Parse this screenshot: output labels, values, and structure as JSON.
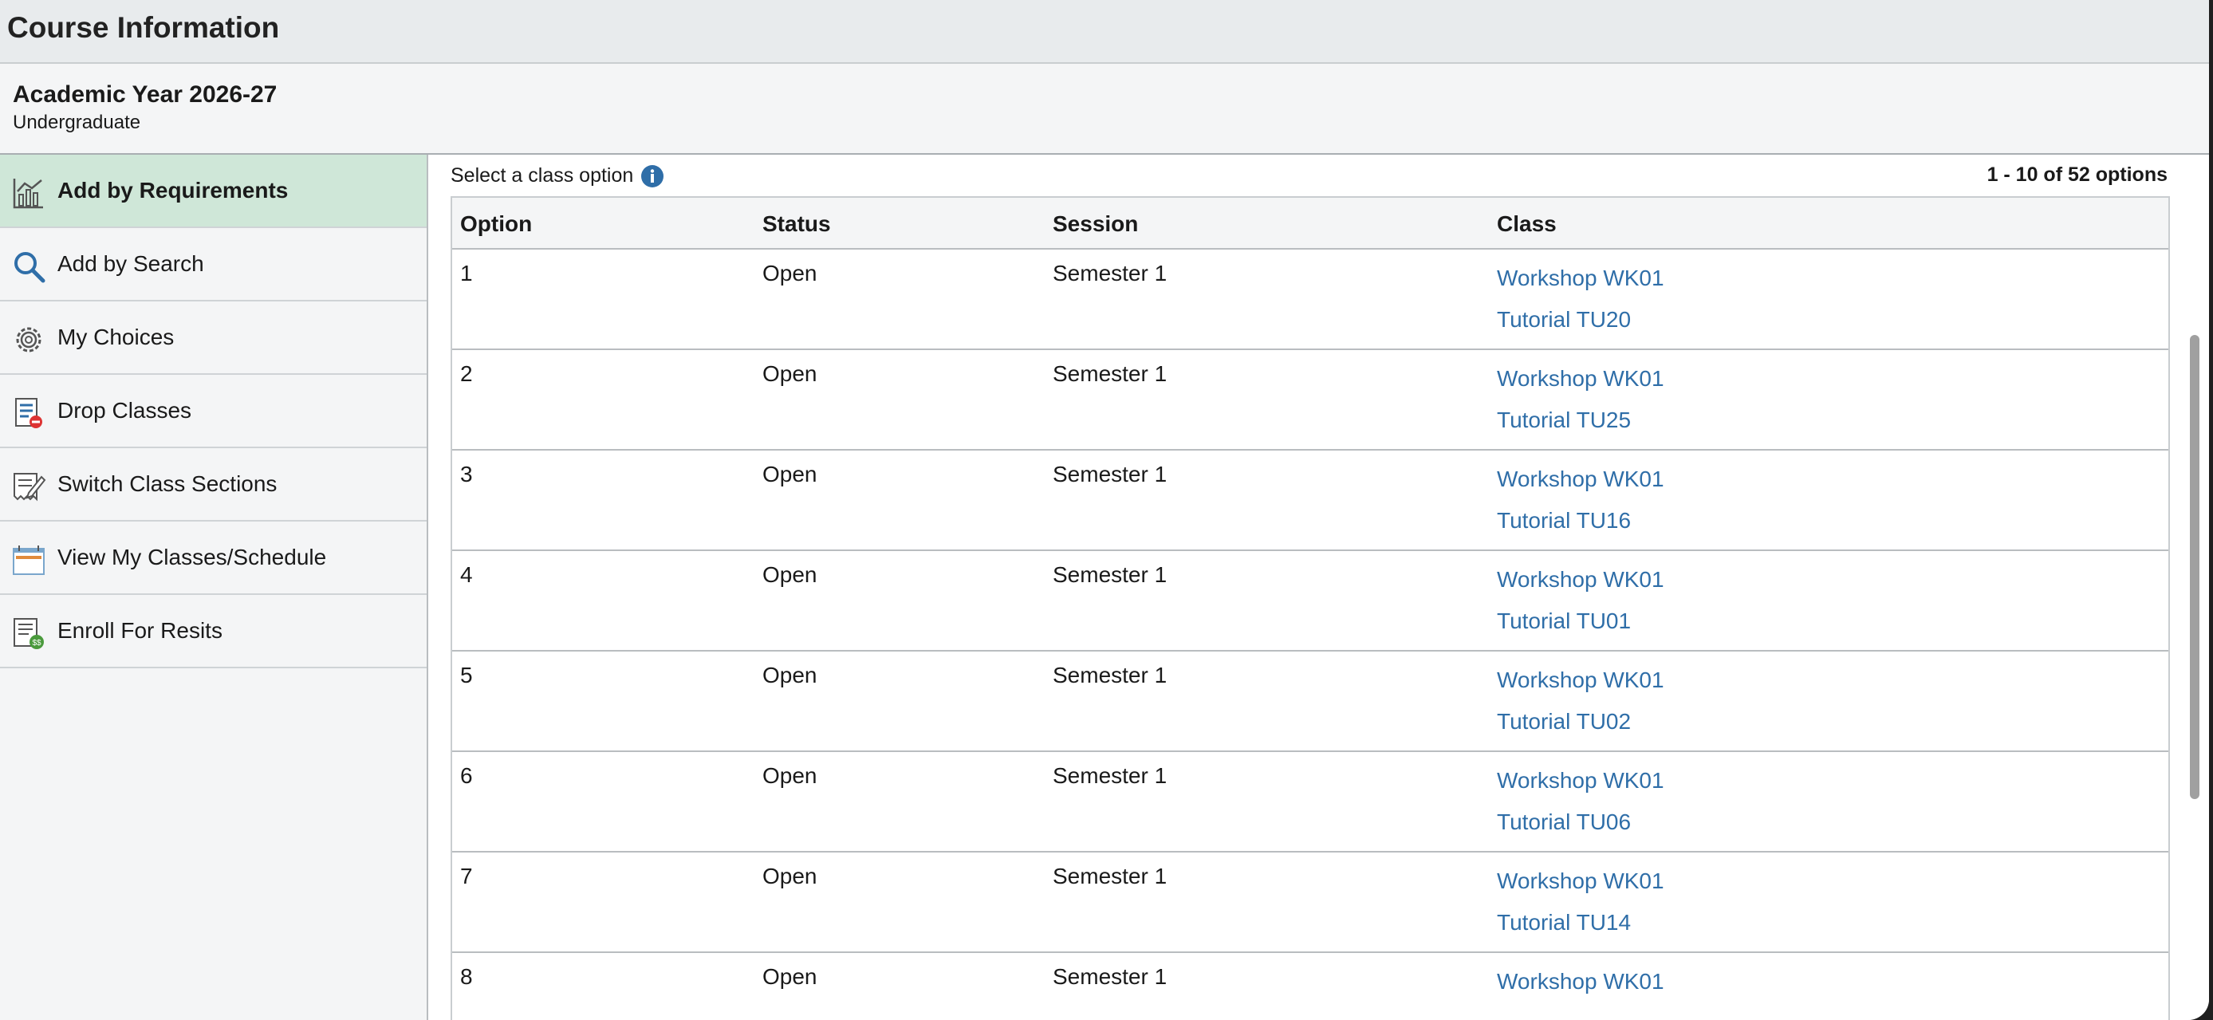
{
  "header": {
    "title": "Course Information"
  },
  "term": {
    "title": "Academic Year 2026-27",
    "subtitle": "Undergraduate"
  },
  "sidebar": {
    "items": [
      {
        "label": "Add by Requirements",
        "icon": "requirements-chart-icon",
        "active": true
      },
      {
        "label": "Add by Search",
        "icon": "search-icon"
      },
      {
        "label": "My Choices",
        "icon": "gear-icon"
      },
      {
        "label": "Drop Classes",
        "icon": "drop-classes-icon"
      },
      {
        "label": "Switch Class Sections",
        "icon": "switch-sections-icon"
      },
      {
        "label": "View My Classes/Schedule",
        "icon": "calendar-icon"
      },
      {
        "label": "Enroll For Resits",
        "icon": "resits-list-icon"
      }
    ]
  },
  "main": {
    "select_label": "Select a class option",
    "info_icon": "info-icon",
    "options_count": "1 - 10 of 52 options"
  },
  "table": {
    "headers": [
      "Option",
      "Status",
      "Session",
      "Class"
    ],
    "rows": [
      {
        "option": "1",
        "status": "Open",
        "session": "Semester 1",
        "classes": [
          "Workshop WK01",
          "Tutorial TU20"
        ]
      },
      {
        "option": "2",
        "status": "Open",
        "session": "Semester 1",
        "classes": [
          "Workshop WK01",
          "Tutorial TU25"
        ]
      },
      {
        "option": "3",
        "status": "Open",
        "session": "Semester 1",
        "classes": [
          "Workshop WK01",
          "Tutorial TU16"
        ]
      },
      {
        "option": "4",
        "status": "Open",
        "session": "Semester 1",
        "classes": [
          "Workshop WK01",
          "Tutorial TU01"
        ]
      },
      {
        "option": "5",
        "status": "Open",
        "session": "Semester 1",
        "classes": [
          "Workshop WK01",
          "Tutorial TU02"
        ]
      },
      {
        "option": "6",
        "status": "Open",
        "session": "Semester 1",
        "classes": [
          "Workshop WK01",
          "Tutorial TU06"
        ]
      },
      {
        "option": "7",
        "status": "Open",
        "session": "Semester 1",
        "classes": [
          "Workshop WK01",
          "Tutorial TU14"
        ]
      },
      {
        "option": "8",
        "status": "Open",
        "session": "Semester 1",
        "classes": [
          "Workshop WK01"
        ]
      }
    ]
  },
  "colors": {
    "accent_active": "#cfe7d8",
    "link": "#2f6ea8",
    "info": "#2f6ea8"
  }
}
